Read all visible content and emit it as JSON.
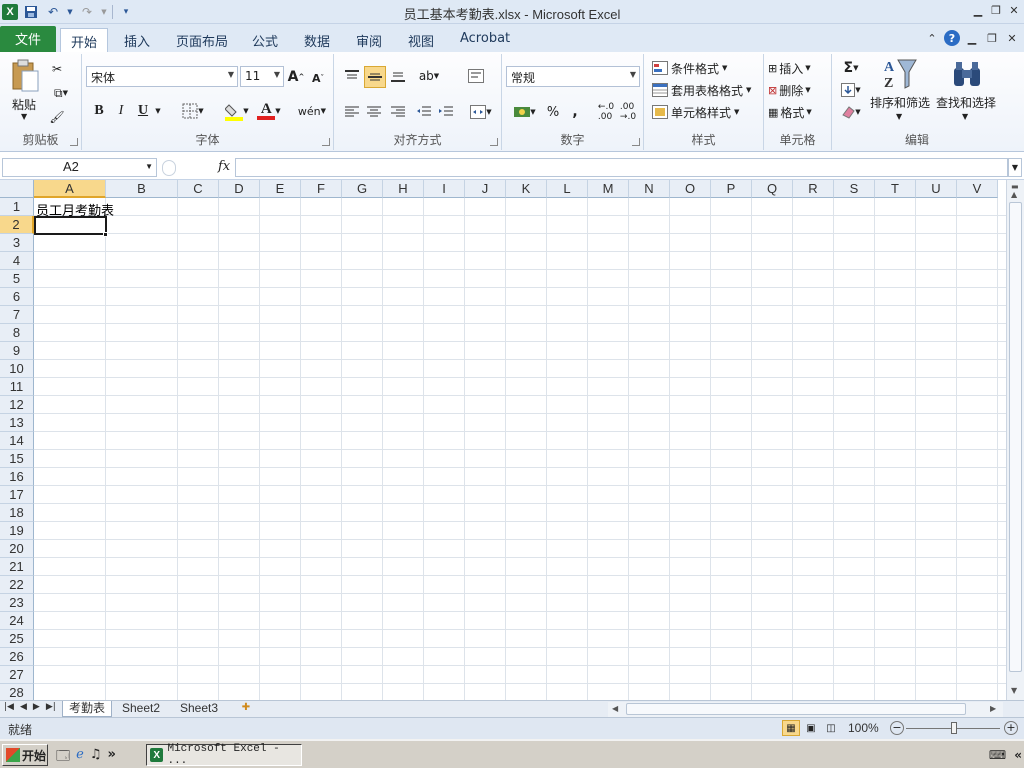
{
  "window": {
    "title": "员工基本考勤表.xlsx - Microsoft Excel",
    "app_icon": "X"
  },
  "qat": {
    "icons": [
      "save-icon",
      "undo-icon",
      "redo-icon",
      "customize-icon"
    ]
  },
  "tabs": [
    {
      "label": "文件"
    },
    {
      "label": "开始"
    },
    {
      "label": "插入"
    },
    {
      "label": "页面布局"
    },
    {
      "label": "公式"
    },
    {
      "label": "数据"
    },
    {
      "label": "审阅"
    },
    {
      "label": "视图"
    },
    {
      "label": "Acrobat"
    }
  ],
  "active_tab": "开始",
  "ribbon": {
    "clipboard": {
      "label": "剪贴板",
      "paste": "粘贴"
    },
    "font": {
      "label": "字体",
      "name": "宋体",
      "size": "11",
      "bold": "B",
      "italic": "I",
      "underline": "U",
      "font_color_glyph": "A"
    },
    "alignment": {
      "label": "对齐方式"
    },
    "number": {
      "label": "数字",
      "format": "常规",
      "percent": "%",
      "comma": ","
    },
    "styles": {
      "label": "样式",
      "conditional": "条件格式",
      "table": "套用表格格式",
      "cell_styles": "单元格样式"
    },
    "cells": {
      "label": "单元格",
      "insert": "插入",
      "delete": "删除",
      "format": "格式"
    },
    "editing": {
      "label": "编辑",
      "sort_filter": "排序和筛选",
      "find_select": "查找和选择",
      "sum_glyph": "Σ"
    }
  },
  "formula_bar": {
    "name_box": "A2",
    "fx": "fx",
    "content": ""
  },
  "columns": [
    "A",
    "B",
    "C",
    "D",
    "E",
    "F",
    "G",
    "H",
    "I",
    "J",
    "K",
    "L",
    "M",
    "N",
    "O",
    "P",
    "Q",
    "R",
    "S",
    "T",
    "U",
    "V"
  ],
  "rows": [
    "1",
    "2",
    "3",
    "4",
    "5",
    "6",
    "7",
    "8",
    "9",
    "10",
    "11",
    "12",
    "13",
    "14",
    "15",
    "16",
    "17",
    "18",
    "19",
    "20",
    "21",
    "22",
    "23",
    "24",
    "25",
    "26",
    "27",
    "28"
  ],
  "selected": {
    "column": "A",
    "row": "2"
  },
  "cells": {
    "A1": "员工月考勤表"
  },
  "sheets": [
    {
      "label": "考勤表",
      "active": true
    },
    {
      "label": "Sheet2",
      "active": false
    },
    {
      "label": "Sheet3",
      "active": false
    }
  ],
  "status": {
    "text": "就绪",
    "zoom": "100%"
  },
  "taskbar": {
    "start": "开始",
    "task": "Microsoft Excel - ..."
  },
  "colors": {
    "file_tab": "#2a8a3f",
    "selection_header": "#f8d88c",
    "accent": "#2b5797"
  }
}
